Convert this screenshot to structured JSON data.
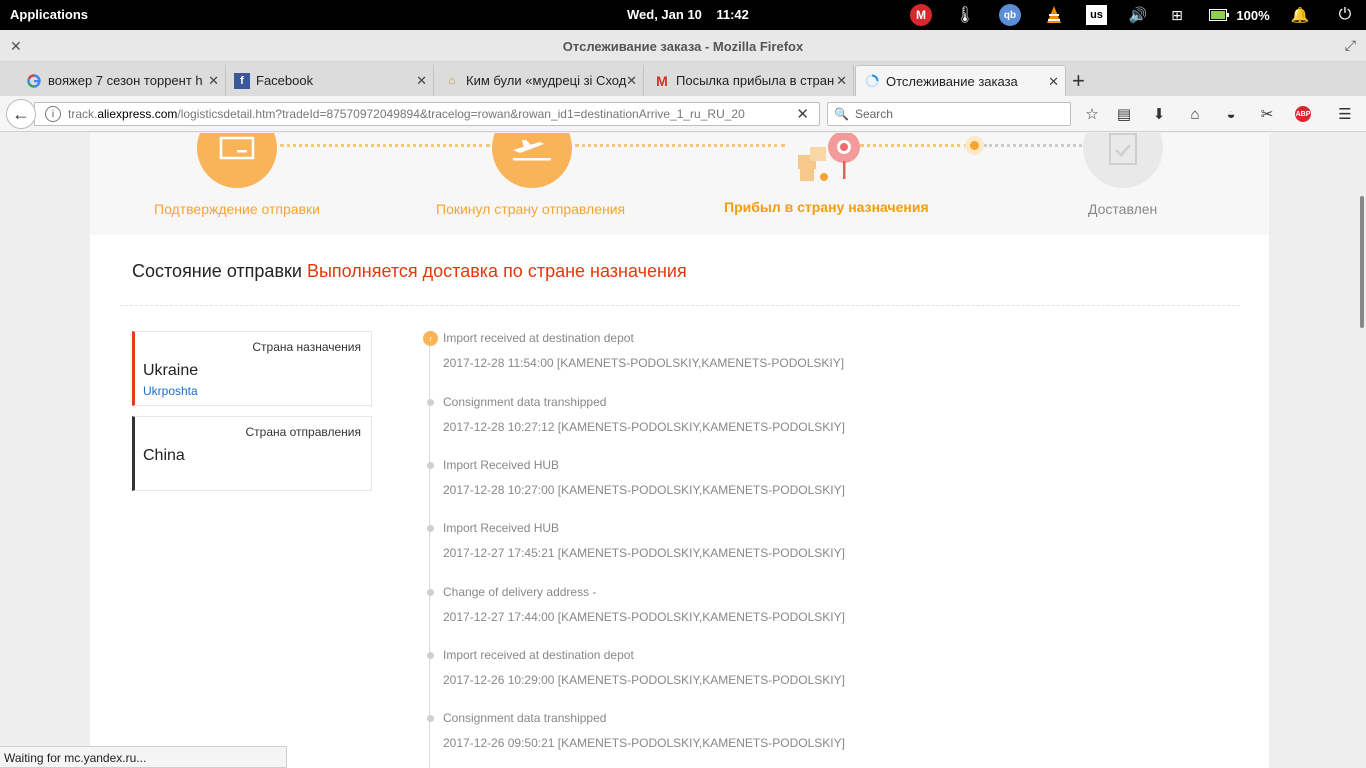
{
  "system": {
    "apps_label": "Applications",
    "clock": "Wed, Jan 10    11:42",
    "keyboard_layout": "us",
    "battery": "100%",
    "mega_icon": "M",
    "qb_icon": "qb"
  },
  "window": {
    "title": "Отслеживание заказа - Mozilla Firefox"
  },
  "tabs": [
    {
      "label": "вояжер 7 сезон торрент h",
      "icon": "google-icon"
    },
    {
      "label": "Facebook",
      "icon": "facebook-icon"
    },
    {
      "label": "Ким були «мудреці зі Сход",
      "icon": "site-icon"
    },
    {
      "label": "Посылка прибыла в стран",
      "icon": "gmail-icon"
    },
    {
      "label": "Отслеживание заказа",
      "icon": "loading-icon"
    }
  ],
  "nav": {
    "url_prefix": "track.",
    "url_domain": "aliexpress.com",
    "url_rest": "/logisticsdetail.htm?tradeId=87570972049894&tracelog=rowan&rowan_id1=destinationArrive_1_ru_RU_20",
    "search_placeholder": "Search",
    "abp_label": "ABP"
  },
  "steps": [
    {
      "label": "Подтверждение отправки",
      "state": "done"
    },
    {
      "label": "Покинул страну отправления",
      "state": "done"
    },
    {
      "label": "Прибыл в страну назначения",
      "state": "current"
    },
    {
      "label": "Доставлен",
      "state": "pending"
    }
  ],
  "shipment": {
    "status_label": "Состояние отправки",
    "status_value": "Выполняется доставка по стране назначения"
  },
  "destination": {
    "header": "Страна назначения",
    "country": "Ukraine",
    "carrier": "Ukrposhta"
  },
  "origin": {
    "header": "Страна отправления",
    "country": "China"
  },
  "timeline": [
    {
      "desc": "Import received at destination depot",
      "time": "2017-12-28 11:54:00 [KAMENETS-PODOLSKIY,KAMENETS-PODOLSKIY]"
    },
    {
      "desc": "Consignment data transhipped",
      "time": "2017-12-28 10:27:12 [KAMENETS-PODOLSKIY,KAMENETS-PODOLSKIY]"
    },
    {
      "desc": "Import Received HUB",
      "time": "2017-12-28 10:27:00 [KAMENETS-PODOLSKIY,KAMENETS-PODOLSKIY]"
    },
    {
      "desc": "Import Received HUB",
      "time": "2017-12-27 17:45:21 [KAMENETS-PODOLSKIY,KAMENETS-PODOLSKIY]"
    },
    {
      "desc": "Change of delivery address -",
      "time": "2017-12-27 17:44:00 [KAMENETS-PODOLSKIY,KAMENETS-PODOLSKIY]"
    },
    {
      "desc": "Import received at destination depot",
      "time": "2017-12-26 10:29:00 [KAMENETS-PODOLSKIY,KAMENETS-PODOLSKIY]"
    },
    {
      "desc": "Consignment data transhipped",
      "time": "2017-12-26 09:50:21 [KAMENETS-PODOLSKIY,KAMENETS-PODOLSKIY]"
    }
  ],
  "statusbar": "Waiting for mc.yandex.ru..."
}
